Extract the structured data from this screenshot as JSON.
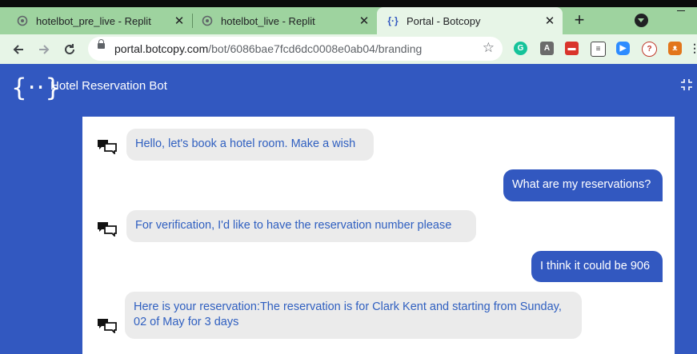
{
  "browser": {
    "tabs": [
      {
        "label": "hotelbot_pre_live - Replit",
        "icon": "replit-icon",
        "active": false
      },
      {
        "label": "hotelbot_live - Replit",
        "icon": "replit-icon",
        "active": false
      },
      {
        "label": "Portal - Botcopy",
        "icon": "botcopy-icon",
        "active": true
      }
    ],
    "new_tab": "+",
    "url_host": "portal.botcopy.com",
    "url_path": "/bot/6086bae7fcd6dc0008e0ab04/branding",
    "extensions": [
      "grammarly-icon",
      "angular-icon",
      "todoist-icon",
      "notes-icon",
      "zoom-icon",
      "reading-icon",
      "metamask-icon"
    ]
  },
  "app": {
    "logo_text": "{··}",
    "title": "Hotel Reservation Bot"
  },
  "chat": {
    "messages": [
      {
        "from": "bot",
        "text": "Hello, let's book a hotel room. Make a wish"
      },
      {
        "from": "user",
        "text": "What are my reservations?"
      },
      {
        "from": "bot",
        "text": "For verification, I'd like to have the reservation number please"
      },
      {
        "from": "user",
        "text": "I think it could be 906"
      },
      {
        "from": "bot",
        "text": "Here is your reservation:The reservation is for Clark Kent and starting from Sunday, 02 of May for 3 days"
      }
    ]
  },
  "colors": {
    "brand_blue": "#3258c0",
    "bot_text": "#2f5fc0",
    "bot_bubble": "#ebebeb",
    "tab_strip": "#9ed39f"
  }
}
